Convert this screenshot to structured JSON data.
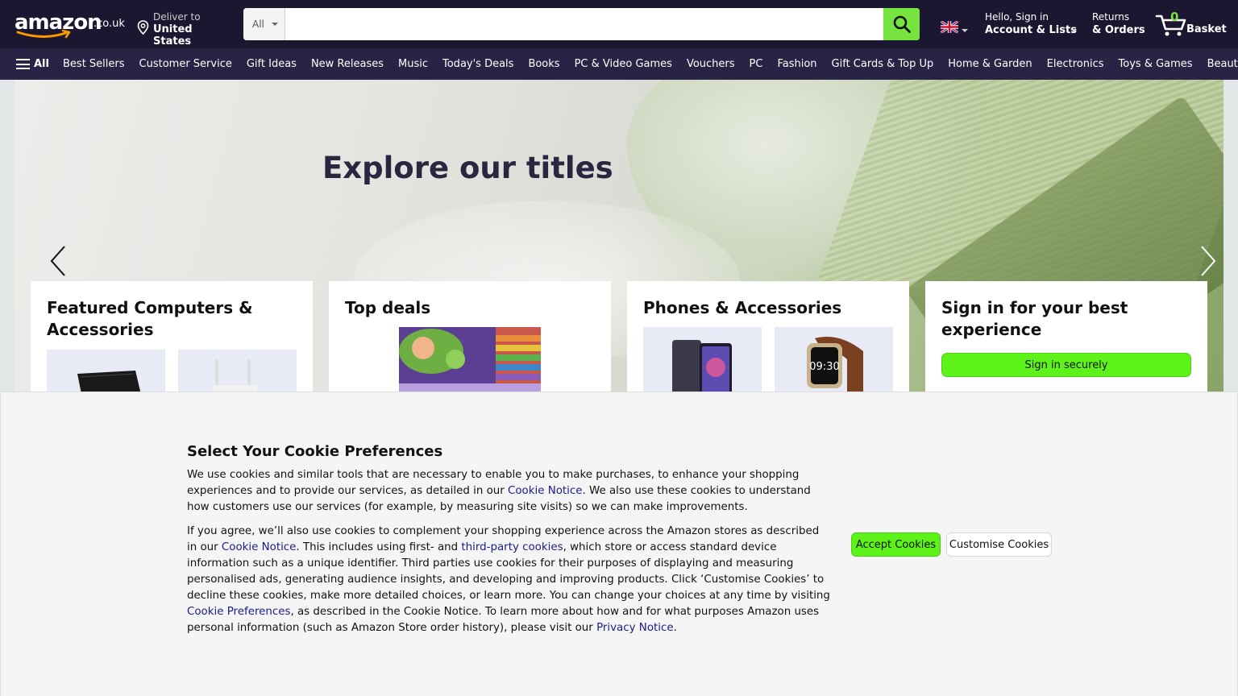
{
  "header": {
    "logo_text": "amazon",
    "logo_tld": ".co.uk",
    "deliver_line1": "Deliver to",
    "deliver_line2": "United States",
    "search_category": "All",
    "search_placeholder": "",
    "account_line1": "Hello, Sign in",
    "account_line2": "Account & Lists",
    "returns_line1": "Returns",
    "returns_line2": "& Orders",
    "basket_count": "0",
    "basket_label": "Basket"
  },
  "nav": {
    "all_label": "All",
    "links": [
      "Best Sellers",
      "Customer Service",
      "Gift Ideas",
      "New Releases",
      "Music",
      "Today's Deals",
      "Books",
      "PC & Video Games",
      "Vouchers",
      "PC",
      "Fashion",
      "Gift Cards & Top Up",
      "Home & Garden",
      "Electronics",
      "Toys & Games",
      "Beauty"
    ]
  },
  "hero": {
    "title": "Explore our titles"
  },
  "cards": [
    {
      "title": "Featured Computers & Accessories"
    },
    {
      "title": "Top deals"
    },
    {
      "title": "Phones & Accessories"
    },
    {
      "title": "Sign in for your best experience",
      "button": "Sign in securely"
    }
  ],
  "cookie": {
    "title": "Select Your Cookie Preferences",
    "p1_a": "We use cookies and similar tools that are necessary to enable you to make purchases, to enhance your shopping experiences and to provide our services, as detailed in our ",
    "p1_link": "Cookie Notice",
    "p1_b": ". We also use these cookies to understand how customers use our services (for example, by measuring site visits) so we can make improvements.",
    "p2_a": "If you agree, we’ll also use cookies to complement your shopping experience across the Amazon stores as described in our ",
    "p2_link1": "Cookie Notice",
    "p2_b": ". This includes using first- and ",
    "p2_link2": "third-party cookies",
    "p2_c": ", which store or access standard device information such as a unique identifier. Third parties use cookies for their purposes of displaying and measuring personalised ads, generating audience insights, and developing and improving products. Click ‘Customise Cookies’ to decline these cookies, make more detailed choices, or learn more. You can change your choices at any time by visiting ",
    "p2_link3": "Cookie Preferences",
    "p2_d": ", as described in the Cookie Notice. To learn more about how and for what purposes Amazon uses personal information (such as Amazon Store order history), please visit our ",
    "p2_link4": "Privacy Notice",
    "p2_e": ".",
    "accept_label": "Accept Cookies",
    "customise_label": "Customise Cookies"
  },
  "colors": {
    "header_bg": "#1b1731",
    "nav_bg": "#2a2345",
    "accent_green": "#5ef21b",
    "link": "#1b1a8c"
  },
  "icons": [
    "amazon-smile-icon",
    "location-pin-icon",
    "search-icon",
    "uk-flag-icon",
    "cart-icon",
    "hamburger-icon",
    "chevron-left-icon",
    "chevron-right-icon"
  ]
}
